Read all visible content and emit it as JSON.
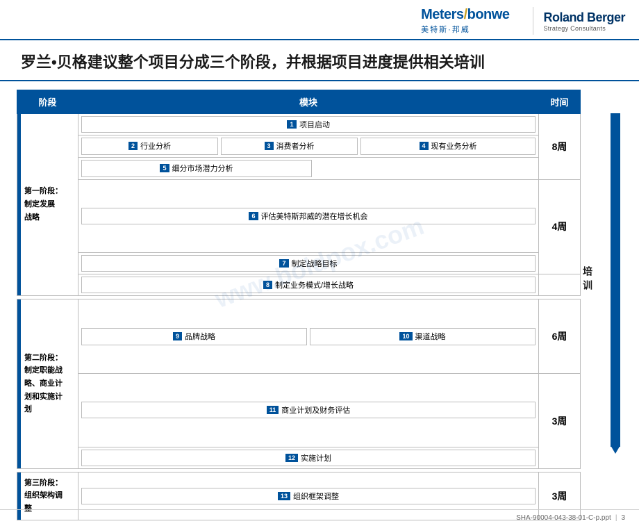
{
  "header": {
    "logo_meters_top": "Meters/bonwe",
    "logo_meters_slash": "/",
    "logo_meters_bottom": "美特斯·邦威",
    "logo_rb_top": "Roland Berger",
    "logo_rb_bottom": "Strategy Consultants"
  },
  "title": "罗兰•贝格建议整个项目分成三个阶段，并根据项目进度提供相关培训",
  "table": {
    "col_phase": "阶段",
    "col_module": "模块",
    "col_time": "时间",
    "phases": [
      {
        "id": "p1",
        "label": "第一阶段：\n制定发展\n战略",
        "time_blocks": [
          "8周",
          "4周"
        ],
        "modules": [
          {
            "num": "1",
            "label": "项目启动",
            "span": "full"
          },
          {
            "row": [
              {
                "num": "2",
                "label": "行业分析",
                "flex": 1
              },
              {
                "num": "3",
                "label": "消费者分析",
                "flex": 1
              },
              {
                "num": "4",
                "label": "现有业务分析",
                "flex": 1.5
              }
            ]
          },
          {
            "num": "5",
            "label": "细分市场潜力分析",
            "span": "half"
          },
          {
            "num": "6",
            "label": "评估美特斯邦威的潜在增长机会",
            "span": "full"
          },
          {
            "num": "7",
            "label": "制定战略目标",
            "span": "full"
          },
          {
            "num": "8",
            "label": "制定业务模式/增长战略",
            "span": "full"
          }
        ]
      },
      {
        "id": "p2",
        "label": "第二阶段：\n制定职能战\n略、商业计\n划和实施计\n划",
        "time_blocks": [
          "6周",
          "3周"
        ],
        "modules": [
          {
            "row": [
              {
                "num": "9",
                "label": "品牌战略",
                "flex": 1
              },
              {
                "num": "10",
                "label": "渠道战略",
                "flex": 1
              }
            ]
          },
          {
            "num": "11",
            "label": "商业计划及财务评估",
            "span": "full"
          },
          {
            "num": "12",
            "label": "实施计划",
            "span": "full"
          }
        ]
      },
      {
        "id": "p3",
        "label": "第三阶段：\n组织架构调\n整",
        "time_blocks": [
          "3周"
        ],
        "modules": [
          {
            "num": "13",
            "label": "组织框架调整",
            "span": "full"
          }
        ]
      }
    ],
    "training_label": "培\n\n训"
  },
  "watermark": "www.boldpox.com",
  "footer": {
    "file_ref": "SHA-90004-043-38-01-C-p.ppt",
    "page_num": "3"
  }
}
